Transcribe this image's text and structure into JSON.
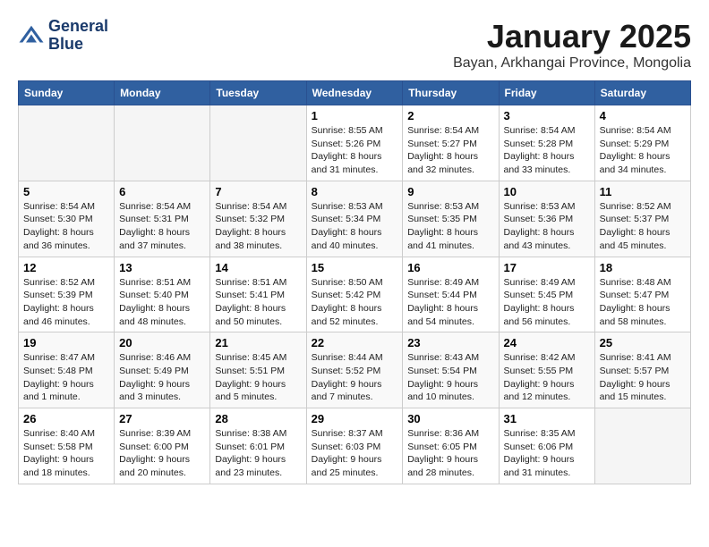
{
  "header": {
    "logo_line1": "General",
    "logo_line2": "Blue",
    "month_title": "January 2025",
    "location": "Bayan, Arkhangai Province, Mongolia"
  },
  "days_of_week": [
    "Sunday",
    "Monday",
    "Tuesday",
    "Wednesday",
    "Thursday",
    "Friday",
    "Saturday"
  ],
  "weeks": [
    [
      {
        "day": "",
        "sunrise": "",
        "sunset": "",
        "daylight": ""
      },
      {
        "day": "",
        "sunrise": "",
        "sunset": "",
        "daylight": ""
      },
      {
        "day": "",
        "sunrise": "",
        "sunset": "",
        "daylight": ""
      },
      {
        "day": "1",
        "sunrise": "Sunrise: 8:55 AM",
        "sunset": "Sunset: 5:26 PM",
        "daylight": "Daylight: 8 hours and 31 minutes."
      },
      {
        "day": "2",
        "sunrise": "Sunrise: 8:54 AM",
        "sunset": "Sunset: 5:27 PM",
        "daylight": "Daylight: 8 hours and 32 minutes."
      },
      {
        "day": "3",
        "sunrise": "Sunrise: 8:54 AM",
        "sunset": "Sunset: 5:28 PM",
        "daylight": "Daylight: 8 hours and 33 minutes."
      },
      {
        "day": "4",
        "sunrise": "Sunrise: 8:54 AM",
        "sunset": "Sunset: 5:29 PM",
        "daylight": "Daylight: 8 hours and 34 minutes."
      }
    ],
    [
      {
        "day": "5",
        "sunrise": "Sunrise: 8:54 AM",
        "sunset": "Sunset: 5:30 PM",
        "daylight": "Daylight: 8 hours and 36 minutes."
      },
      {
        "day": "6",
        "sunrise": "Sunrise: 8:54 AM",
        "sunset": "Sunset: 5:31 PM",
        "daylight": "Daylight: 8 hours and 37 minutes."
      },
      {
        "day": "7",
        "sunrise": "Sunrise: 8:54 AM",
        "sunset": "Sunset: 5:32 PM",
        "daylight": "Daylight: 8 hours and 38 minutes."
      },
      {
        "day": "8",
        "sunrise": "Sunrise: 8:53 AM",
        "sunset": "Sunset: 5:34 PM",
        "daylight": "Daylight: 8 hours and 40 minutes."
      },
      {
        "day": "9",
        "sunrise": "Sunrise: 8:53 AM",
        "sunset": "Sunset: 5:35 PM",
        "daylight": "Daylight: 8 hours and 41 minutes."
      },
      {
        "day": "10",
        "sunrise": "Sunrise: 8:53 AM",
        "sunset": "Sunset: 5:36 PM",
        "daylight": "Daylight: 8 hours and 43 minutes."
      },
      {
        "day": "11",
        "sunrise": "Sunrise: 8:52 AM",
        "sunset": "Sunset: 5:37 PM",
        "daylight": "Daylight: 8 hours and 45 minutes."
      }
    ],
    [
      {
        "day": "12",
        "sunrise": "Sunrise: 8:52 AM",
        "sunset": "Sunset: 5:39 PM",
        "daylight": "Daylight: 8 hours and 46 minutes."
      },
      {
        "day": "13",
        "sunrise": "Sunrise: 8:51 AM",
        "sunset": "Sunset: 5:40 PM",
        "daylight": "Daylight: 8 hours and 48 minutes."
      },
      {
        "day": "14",
        "sunrise": "Sunrise: 8:51 AM",
        "sunset": "Sunset: 5:41 PM",
        "daylight": "Daylight: 8 hours and 50 minutes."
      },
      {
        "day": "15",
        "sunrise": "Sunrise: 8:50 AM",
        "sunset": "Sunset: 5:42 PM",
        "daylight": "Daylight: 8 hours and 52 minutes."
      },
      {
        "day": "16",
        "sunrise": "Sunrise: 8:49 AM",
        "sunset": "Sunset: 5:44 PM",
        "daylight": "Daylight: 8 hours and 54 minutes."
      },
      {
        "day": "17",
        "sunrise": "Sunrise: 8:49 AM",
        "sunset": "Sunset: 5:45 PM",
        "daylight": "Daylight: 8 hours and 56 minutes."
      },
      {
        "day": "18",
        "sunrise": "Sunrise: 8:48 AM",
        "sunset": "Sunset: 5:47 PM",
        "daylight": "Daylight: 8 hours and 58 minutes."
      }
    ],
    [
      {
        "day": "19",
        "sunrise": "Sunrise: 8:47 AM",
        "sunset": "Sunset: 5:48 PM",
        "daylight": "Daylight: 9 hours and 1 minute."
      },
      {
        "day": "20",
        "sunrise": "Sunrise: 8:46 AM",
        "sunset": "Sunset: 5:49 PM",
        "daylight": "Daylight: 9 hours and 3 minutes."
      },
      {
        "day": "21",
        "sunrise": "Sunrise: 8:45 AM",
        "sunset": "Sunset: 5:51 PM",
        "daylight": "Daylight: 9 hours and 5 minutes."
      },
      {
        "day": "22",
        "sunrise": "Sunrise: 8:44 AM",
        "sunset": "Sunset: 5:52 PM",
        "daylight": "Daylight: 9 hours and 7 minutes."
      },
      {
        "day": "23",
        "sunrise": "Sunrise: 8:43 AM",
        "sunset": "Sunset: 5:54 PM",
        "daylight": "Daylight: 9 hours and 10 minutes."
      },
      {
        "day": "24",
        "sunrise": "Sunrise: 8:42 AM",
        "sunset": "Sunset: 5:55 PM",
        "daylight": "Daylight: 9 hours and 12 minutes."
      },
      {
        "day": "25",
        "sunrise": "Sunrise: 8:41 AM",
        "sunset": "Sunset: 5:57 PM",
        "daylight": "Daylight: 9 hours and 15 minutes."
      }
    ],
    [
      {
        "day": "26",
        "sunrise": "Sunrise: 8:40 AM",
        "sunset": "Sunset: 5:58 PM",
        "daylight": "Daylight: 9 hours and 18 minutes."
      },
      {
        "day": "27",
        "sunrise": "Sunrise: 8:39 AM",
        "sunset": "Sunset: 6:00 PM",
        "daylight": "Daylight: 9 hours and 20 minutes."
      },
      {
        "day": "28",
        "sunrise": "Sunrise: 8:38 AM",
        "sunset": "Sunset: 6:01 PM",
        "daylight": "Daylight: 9 hours and 23 minutes."
      },
      {
        "day": "29",
        "sunrise": "Sunrise: 8:37 AM",
        "sunset": "Sunset: 6:03 PM",
        "daylight": "Daylight: 9 hours and 25 minutes."
      },
      {
        "day": "30",
        "sunrise": "Sunrise: 8:36 AM",
        "sunset": "Sunset: 6:05 PM",
        "daylight": "Daylight: 9 hours and 28 minutes."
      },
      {
        "day": "31",
        "sunrise": "Sunrise: 8:35 AM",
        "sunset": "Sunset: 6:06 PM",
        "daylight": "Daylight: 9 hours and 31 minutes."
      },
      {
        "day": "",
        "sunrise": "",
        "sunset": "",
        "daylight": ""
      }
    ]
  ]
}
